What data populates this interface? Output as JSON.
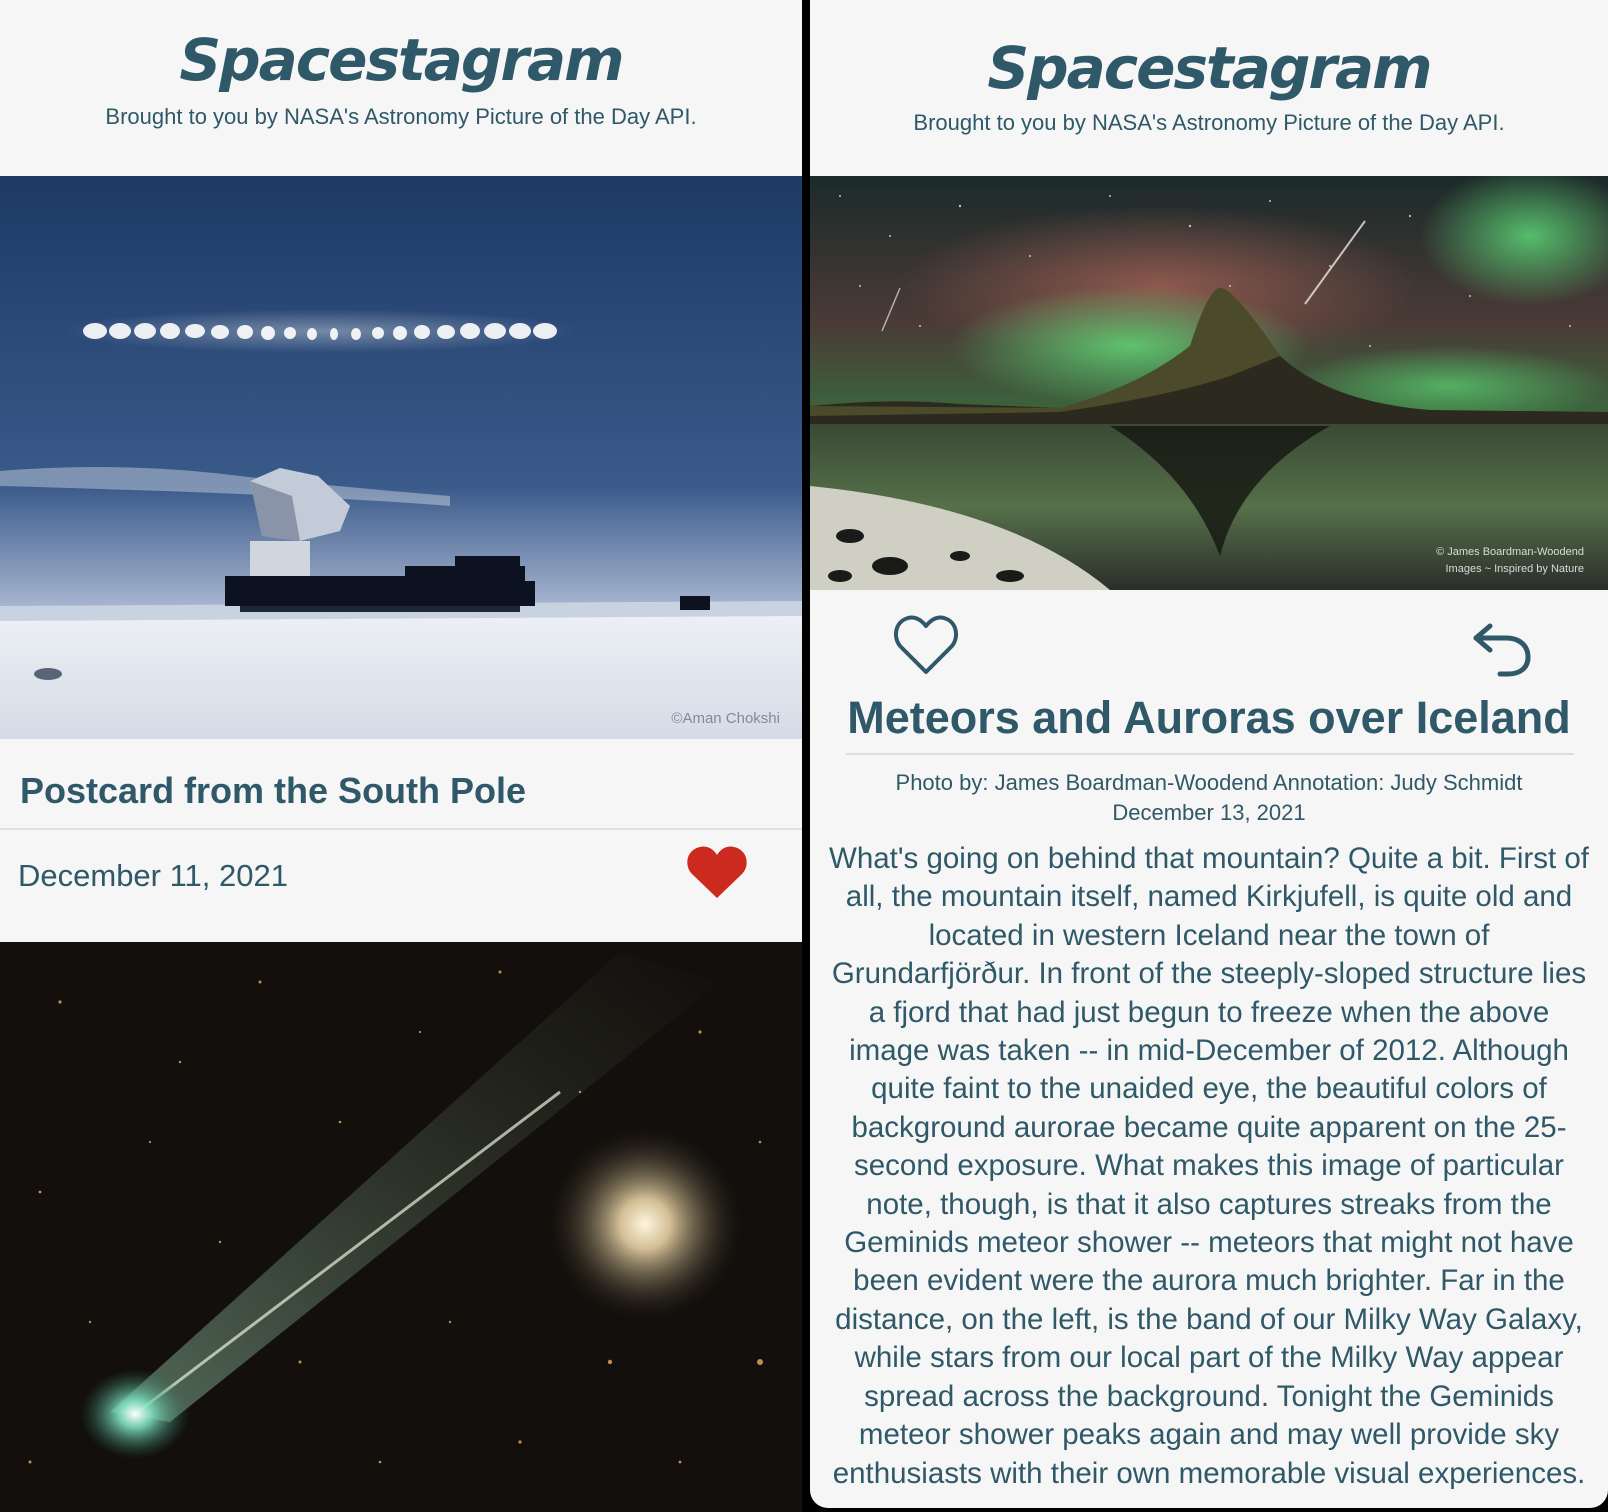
{
  "left_screen": {
    "brand": {
      "title": "Spacestagram",
      "subtitle": "Brought to you by NASA's Astronomy Picture of the Day API."
    },
    "card_1": {
      "image_credit": "©Aman Chokshi",
      "title": "Postcard from the South Pole",
      "date": "December 11, 2021",
      "liked": true,
      "like_icon": "heart-filled-icon",
      "like_color": "#cc2a1e"
    }
  },
  "right_screen": {
    "brand": {
      "title": "Spacestagram",
      "subtitle": "Brought to you by NASA's Astronomy Picture of the Day API."
    },
    "detail": {
      "image_credit_line1": "© James Boardman-Woodend",
      "image_credit_line2": "Images ~ Inspired by Nature",
      "like_icon": "heart-outline-icon",
      "back_icon": "back-arrow-icon",
      "title": "Meteors and Auroras over Iceland",
      "credits": "Photo by: James Boardman-Woodend Annotation: Judy Schmidt",
      "date": "December 13, 2021",
      "description": "What's going on behind that mountain? Quite a bit. First of all, the mountain itself, named Kirkjufell, is quite old and located in western Iceland near the town of Grundarfjörður. In front of the steeply-sloped structure lies a fjord that had just begun to freeze when the above image was taken -- in mid-December of 2012. Although quite faint to the unaided eye, the beautiful colors of background aurorae became quite apparent on the 25-second exposure. What makes this image of particular note, though, is that it also captures streaks from the Geminids meteor shower -- meteors that might not have been evident were the aurora much brighter. Far in the distance, on the left, is the band of our Milky Way Galaxy, while stars from our local part of the Milky Way appear spread across the background. Tonight the Geminids meteor shower peaks again and may well provide sky enthusiasts with their own memorable visual experiences."
    }
  },
  "colors": {
    "brand_text": "#2f5868",
    "background": "#f6f6f6",
    "like_red": "#cc2a1e"
  }
}
